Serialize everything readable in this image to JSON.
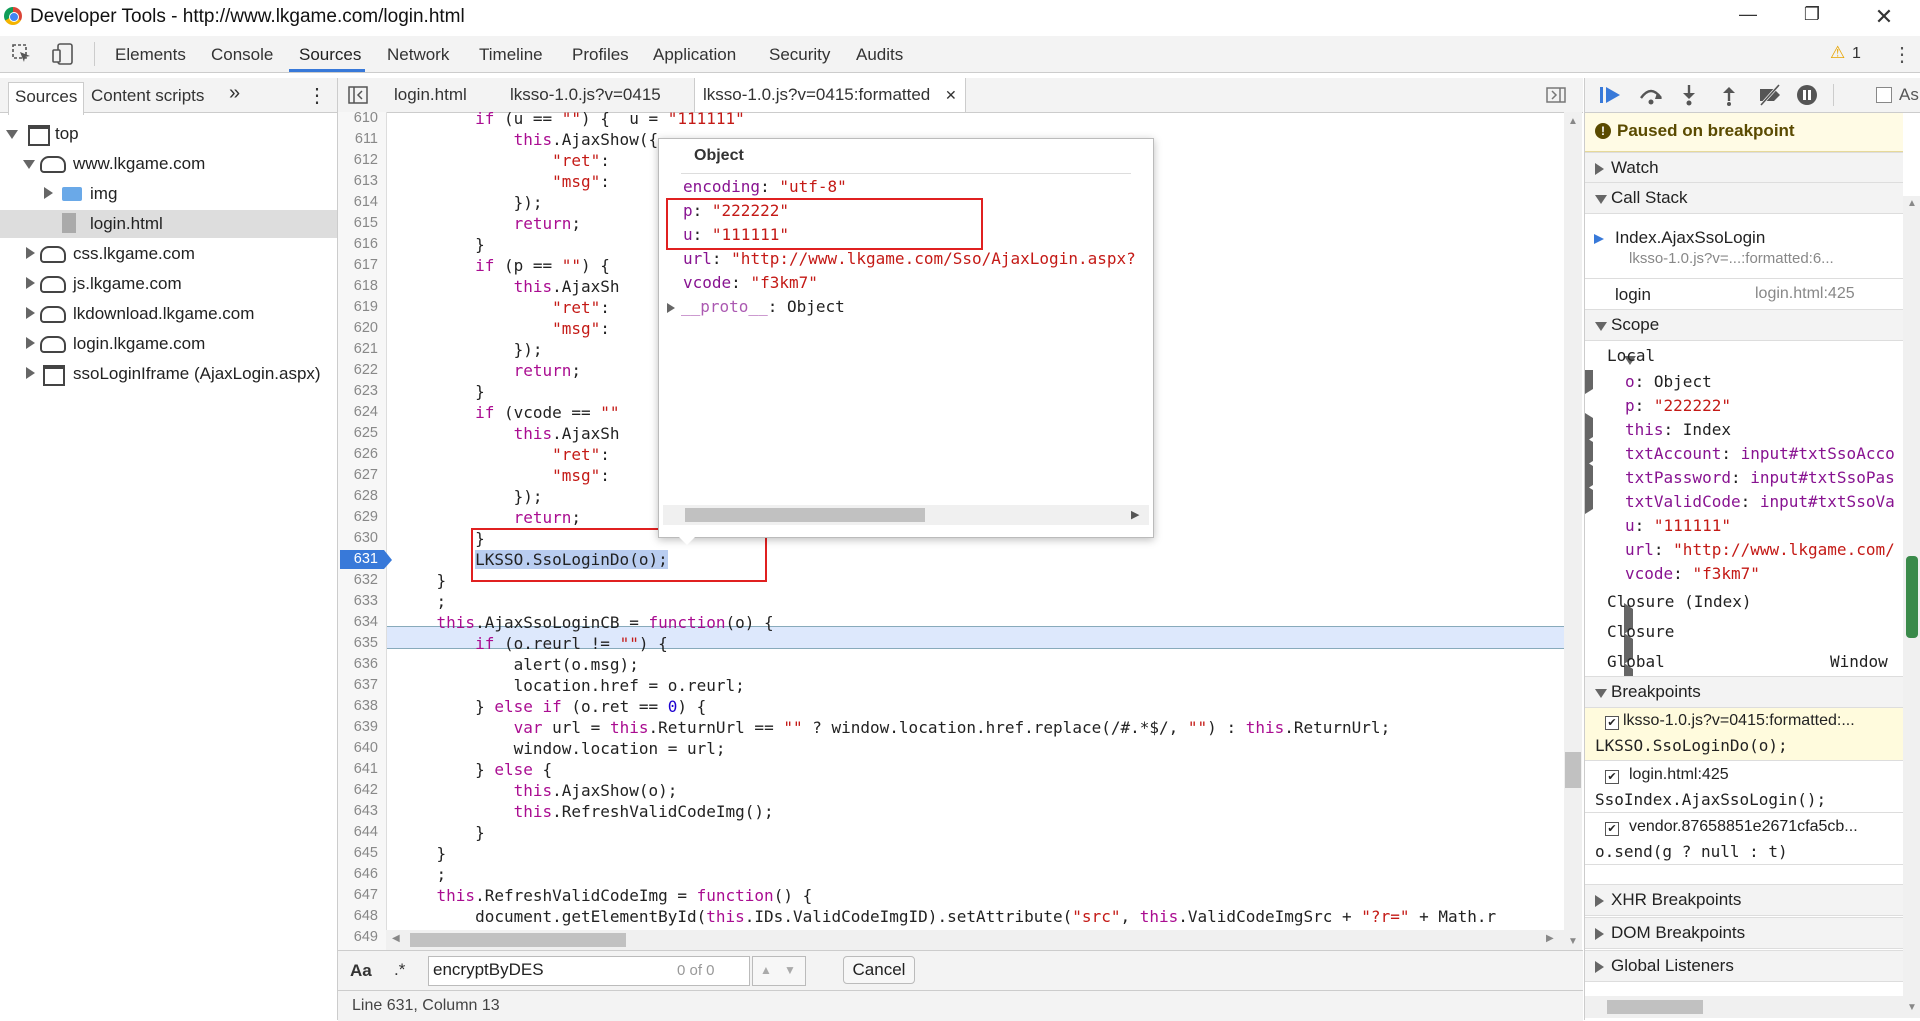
{
  "window": {
    "title": "Developer Tools - http://www.lkgame.com/login.html",
    "min": "—",
    "max": "❐",
    "close": "✕"
  },
  "toolbar": {
    "tabs": [
      "Elements",
      "Console",
      "Sources",
      "Network",
      "Timeline",
      "Profiles",
      "Application",
      "Security",
      "Audits"
    ],
    "warning_count": "1",
    "warning_icon": "⚠",
    "more": "⋮"
  },
  "navigator": {
    "tabs": [
      "Sources",
      "Content scripts"
    ],
    "more": "»",
    "menu": "⋮",
    "tree": [
      "top",
      "www.lkgame.com",
      "img",
      "login.html",
      "css.lkgame.com",
      "js.lkgame.com",
      "lkdownload.lkgame.com",
      "login.lkgame.com",
      "ssoLoginIframe (AjaxLogin.aspx)"
    ]
  },
  "editor": {
    "tabs": [
      "login.html",
      "lksso-1.0.js?v=0415",
      "lksso-1.0.js?v=0415:formatted"
    ],
    "tab_close": "✕",
    "line_numbers": [
      "610",
      "611",
      "612",
      "613",
      "614",
      "615",
      "616",
      "617",
      "618",
      "619",
      "620",
      "621",
      "622",
      "623",
      "624",
      "625",
      "626",
      "627",
      "628",
      "629",
      "630",
      "631",
      "632",
      "633",
      "634",
      "635",
      "636",
      "637",
      "638",
      "639",
      "640",
      "641",
      "642",
      "643",
      "644",
      "645",
      "646",
      "647",
      "648",
      "649"
    ],
    "code": [
      "        if (u == \"\") {  u = \"111111\"",
      "            this.AjaxShow({",
      "                \"ret\":",
      "                \"msg\":",
      "            });",
      "            return;",
      "        }",
      "        if (p == \"\") {",
      "            this.AjaxSh",
      "                \"ret\":",
      "                \"msg\":",
      "            });",
      "            return;",
      "        }",
      "        if (vcode == \"\"",
      "            this.AjaxSh",
      "                \"ret\":",
      "                \"msg\":",
      "            });",
      "            return;",
      "        }",
      "        LKSSO.SsoLoginDo(o);",
      "    }",
      "    ;",
      "    this.AjaxSsoLoginCB = function(o) {",
      "        if (o.reurl != \"\") {",
      "            alert(o.msg);",
      "            location.href = o.reurl;",
      "        } else if (o.ret == 0) {",
      "            var url = this.ReturnUrl == \"\" ? window.location.href.replace(/#.*$/, \"\") : this.ReturnUrl;",
      "            window.location = url;",
      "        } else {",
      "            this.AjaxShow(o);",
      "            this.RefreshValidCodeImg();",
      "        }",
      "    }",
      "    ;",
      "    this.RefreshValidCodeImg = function() {",
      "        document.getElementById(this.IDs.ValidCodeImgID).setAttribute(\"src\", this.ValidCodeImgSrc + \"?r=\" + Math.r",
      ""
    ],
    "search": {
      "aa": "Aa",
      "regex": ".*",
      "value": "encryptByDES",
      "count": "0 of 0",
      "up": "▲",
      "down": "▼",
      "cancel": "Cancel"
    },
    "status": "Line 631, Column 13"
  },
  "popover": {
    "title": "Object",
    "rows": [
      {
        "k": "encoding",
        "v": "\"utf-8\""
      },
      {
        "k": "p",
        "v": "\"222222\""
      },
      {
        "k": "u",
        "v": "\"111111\""
      },
      {
        "k": "url",
        "v": "\"http://www.lkgame.com/Sso/AjaxLogin.aspx?"
      },
      {
        "k": "vcode",
        "v": "\"f3km7\""
      },
      {
        "k": "__proto__",
        "v": "Object"
      }
    ]
  },
  "sidebar": {
    "paused": "Paused on breakpoint",
    "async": "As",
    "sections": {
      "watch": "Watch",
      "callstack": "Call Stack",
      "scope": "Scope",
      "breakpoints": "Breakpoints",
      "xhr": "XHR Breakpoints",
      "dom": "DOM Breakpoints",
      "global": "Global Listeners"
    },
    "callstack": [
      {
        "fn": "Index.AjaxSsoLogin",
        "loc": "lksso-1.0.js?v=...:formatted:6..."
      },
      {
        "fn": "login",
        "loc": "login.html:425"
      }
    ],
    "scope": {
      "local": "Local",
      "rows": [
        {
          "k": "o",
          "v": "Object"
        },
        {
          "k": "p",
          "v": "\"222222\""
        },
        {
          "k": "this",
          "v": "Index"
        },
        {
          "k": "txtAccount",
          "v": "input#txtSsoAcco"
        },
        {
          "k": "txtPassword",
          "v": "input#txtSsoPas"
        },
        {
          "k": "txtValidCode",
          "v": "input#txtSsoVa"
        },
        {
          "k": "u",
          "v": "\"111111\""
        },
        {
          "k": "url",
          "v": "\"http://www.lkgame.com/"
        },
        {
          "k": "vcode",
          "v": "\"f3km7\""
        }
      ],
      "closure_index": "Closure (Index)",
      "closure": "Closure",
      "global": "Global",
      "global_val": "Window"
    },
    "breakpoints": [
      {
        "file": "lksso-1.0.js?v=0415:formatted:...",
        "code": "LKSSO.SsoLoginDo(o);"
      },
      {
        "file": "login.html:425",
        "code": "SsoIndex.AjaxSsoLogin();"
      },
      {
        "file": "vendor.87658851e2671cfa5cb...",
        "code": "o.send(g ? null : t)"
      }
    ]
  },
  "colors": {
    "accent": "#3879d9",
    "highlight": "#e02020",
    "paused_bg": "#fffbe5"
  }
}
